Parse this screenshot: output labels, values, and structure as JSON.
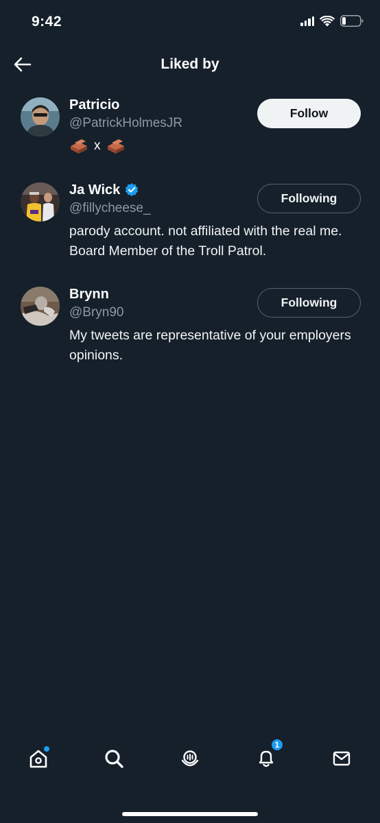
{
  "status_bar": {
    "time": "9:42"
  },
  "header": {
    "title": "Liked by"
  },
  "users": [
    {
      "name": "Patricio",
      "handle": "@PatrickHolmesJR",
      "verified": false,
      "bio_separator": "x",
      "button_label": "Follow"
    },
    {
      "name": "Ja Wick",
      "handle": "@fillycheese_",
      "verified": true,
      "bio": "parody account. not affiliated with the real me. Board Member of the Troll Patrol.",
      "button_label": "Following"
    },
    {
      "name": "Brynn",
      "handle": "@Bryn90",
      "verified": false,
      "bio": "My tweets are representative of your employers opinions.",
      "button_label": "Following"
    }
  ],
  "bottom_nav": {
    "items": [
      "home-icon",
      "search-icon",
      "spaces-icon",
      "notifications-icon",
      "messages-icon"
    ],
    "notifications_badge": "1"
  },
  "colors": {
    "background": "#15202b",
    "secondary_text": "#8b98a5",
    "accent": "#1d9bf0",
    "verified": "#1d9bf0"
  }
}
